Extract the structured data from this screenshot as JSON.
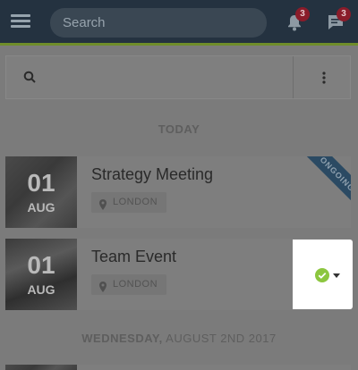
{
  "header": {
    "search_placeholder": "Search",
    "notifications_count": "3",
    "messages_count": "3",
    "accent_color": "#6f8d2a",
    "bar_color": "#243240"
  },
  "toolbar": {
    "search_icon": "search-icon",
    "menu_icon": "kebab-icon"
  },
  "sections": [
    {
      "label": "TODAY",
      "events": [
        {
          "day": "01",
          "month": "AUG",
          "title": "Strategy Meeting",
          "location": "LONDON",
          "ribbon": "ONGOING"
        },
        {
          "day": "01",
          "month": "AUG",
          "title": "Team Event",
          "location": "LONDON",
          "status": "accepted"
        }
      ]
    },
    {
      "label_bold": "WEDNESDAY,",
      "label_rest": " AUGUST 2ND 2017"
    }
  ]
}
